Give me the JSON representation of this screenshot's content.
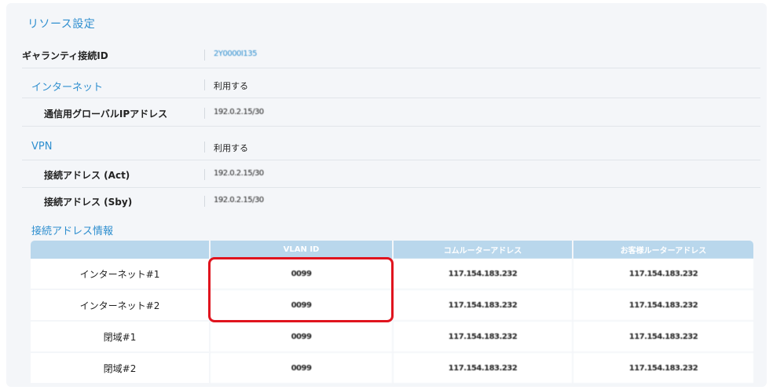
{
  "resource": {
    "title": "リソース設定",
    "guaranty_id": {
      "label": "ギャランティ接続ID",
      "value": "2Y0000I135"
    },
    "internet": {
      "label": "インターネット",
      "value": "利用する"
    },
    "global_ip": {
      "label": "通信用グローバルIPアドレス",
      "value": "192.0.2.15/30"
    },
    "vpn": {
      "label": "VPN",
      "value": "利用する"
    },
    "act": {
      "label": "接続アドレス (Act)",
      "value": "192.0.2.15/30"
    },
    "sby": {
      "label": "接続アドレス (Sby)",
      "value": "192.0.2.15/30"
    }
  },
  "address_info": {
    "title": "接続アドレス情報",
    "columns": [
      "",
      "VLAN ID",
      "コムルーターアドレス",
      "お客様ルーターアドレス"
    ],
    "rows": [
      {
        "name": "インターネット#1",
        "vlan": "0099",
        "com": "117.154.183.232",
        "cust": "117.154.183.232"
      },
      {
        "name": "インターネット#2",
        "vlan": "0099",
        "com": "117.154.183.232",
        "cust": "117.154.183.232"
      },
      {
        "name": "閉域#1",
        "vlan": "0099",
        "com": "117.154.183.232",
        "cust": "117.154.183.232"
      },
      {
        "name": "閉域#2",
        "vlan": "0099",
        "com": "117.154.183.232",
        "cust": "117.154.183.232"
      }
    ]
  },
  "colors": {
    "accent": "#2f8fcf",
    "header_bg": "#b9d7ec",
    "highlight": "#e0141e"
  }
}
